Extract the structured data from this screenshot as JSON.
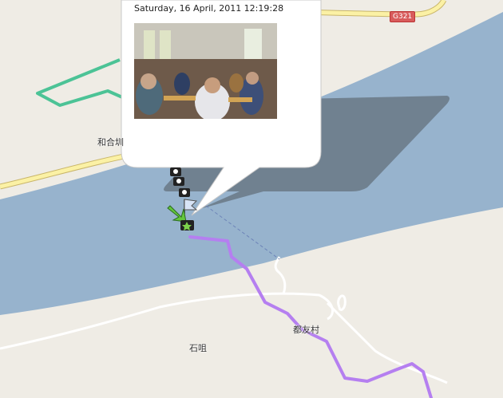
{
  "map": {
    "labels": {
      "place_hehe": "和合圳",
      "place_duyou": "都友村",
      "place_shiju": "石咀"
    },
    "road_shield": "G321",
    "colors": {
      "land": "#efece5",
      "water": "#97b3cd",
      "road_major": "#fbf1a5",
      "road_minor": "#ffffff",
      "track": "#b57ff0",
      "boundary": "#4cc396",
      "shadow": "#50585e"
    }
  },
  "popup": {
    "timestamp": "Saturday, 16 April, 2011 12:19:28",
    "photo_alt": "Photo of people eating in a restaurant"
  },
  "markers": {
    "camera_icons": [
      "camera-icon",
      "camera-icon",
      "camera-icon",
      "camera-icon"
    ],
    "flag_icon": "flag-icon",
    "arrow_icon": "green-arrow-icon",
    "start_icon": "start-star-icon"
  }
}
